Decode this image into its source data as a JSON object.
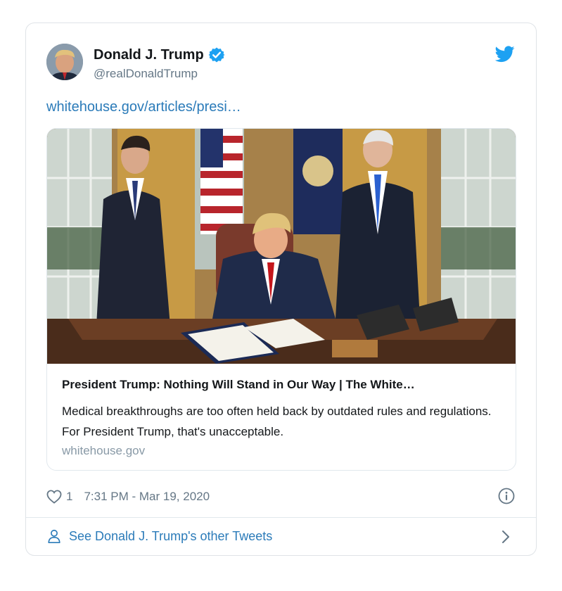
{
  "author": {
    "name": "Donald J. Trump",
    "handle": "@realDonaldTrump"
  },
  "tweet": {
    "link_text": "whitehouse.gov/articles/presi…"
  },
  "link_card": {
    "title": "President Trump: Nothing Will Stand in Our Way | The White…",
    "description": "Medical breakthroughs are too often held back by outdated rules and regulations. For President Trump, that's unacceptable.",
    "domain": "whitehouse.gov"
  },
  "meta": {
    "like_count": "1",
    "timestamp": "7:31 PM - Mar 19, 2020"
  },
  "footer": {
    "see_more": "See Donald J. Trump's other Tweets"
  },
  "icons": {
    "verified": "verified-badge-icon",
    "brand": "twitter-bird-icon",
    "like": "heart-icon",
    "info": "info-icon",
    "profile": "person-icon",
    "more": "chevron-right-icon"
  },
  "colors": {
    "link": "#2b7bb9",
    "twitter_blue": "#1da1f2",
    "secondary_text": "#657786",
    "border": "#e1e8ed"
  }
}
